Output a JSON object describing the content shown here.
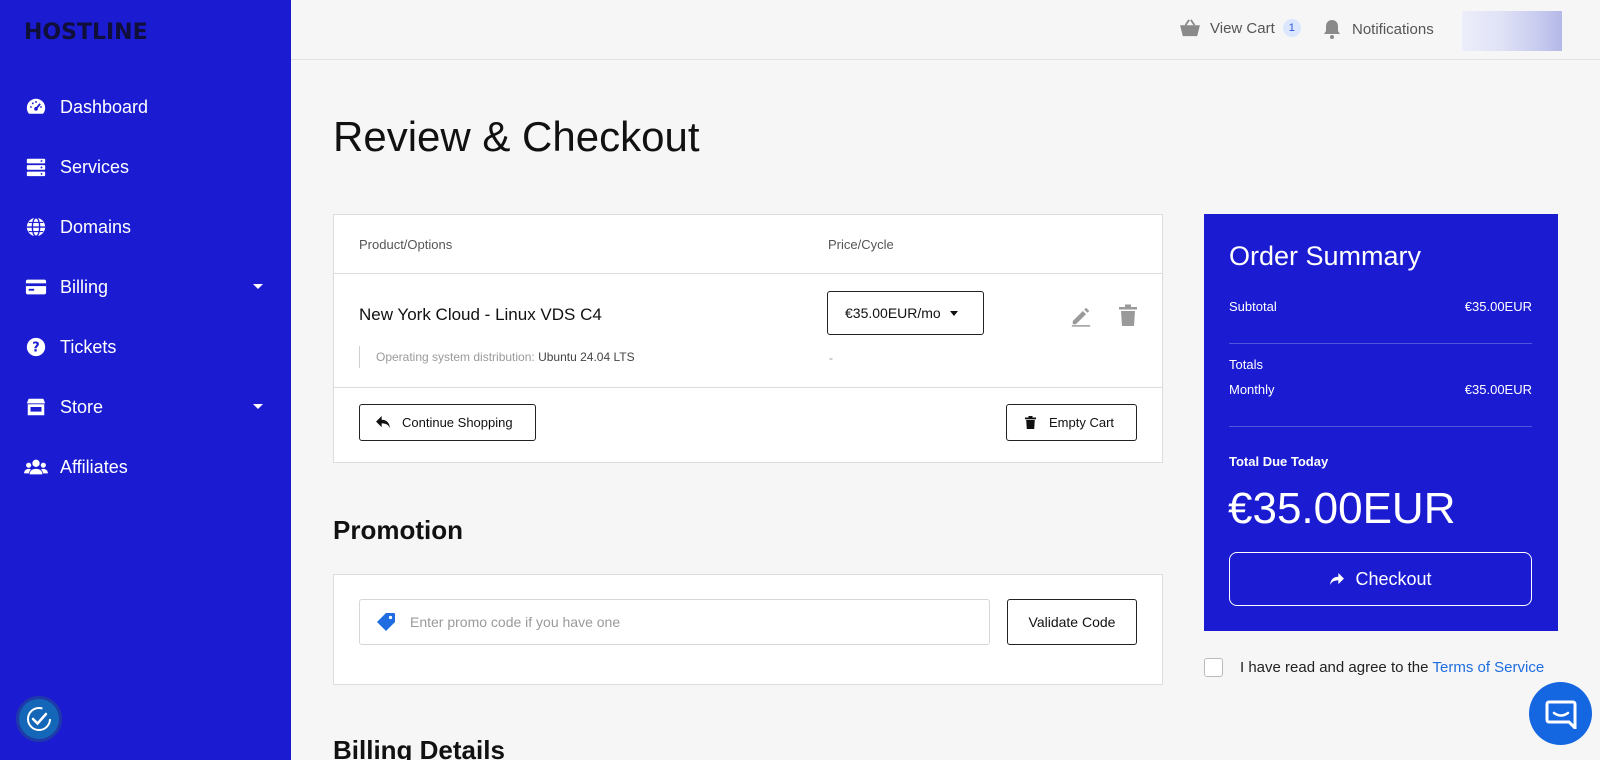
{
  "brand": {
    "logo": "HOSTLINE"
  },
  "sidebar": {
    "items": [
      {
        "label": "Dashboard",
        "icon": "dashboard-gauge-icon",
        "has_caret": false
      },
      {
        "label": "Services",
        "icon": "server-icon",
        "has_caret": false
      },
      {
        "label": "Domains",
        "icon": "globe-icon",
        "has_caret": false
      },
      {
        "label": "Billing",
        "icon": "credit-card-icon",
        "has_caret": true
      },
      {
        "label": "Tickets",
        "icon": "question-circle-icon",
        "has_caret": false
      },
      {
        "label": "Store",
        "icon": "store-icon",
        "has_caret": true
      },
      {
        "label": "Affiliates",
        "icon": "users-icon",
        "has_caret": false
      }
    ]
  },
  "topbar": {
    "cart_label": "View Cart",
    "cart_count": "1",
    "notifications_label": "Notifications"
  },
  "page": {
    "title": "Review & Checkout"
  },
  "cart": {
    "headers": {
      "product": "Product/Options",
      "price": "Price/Cycle"
    },
    "item": {
      "name": "New York Cloud - Linux VDS C4",
      "option_label": "Operating system distribution:",
      "option_value": "Ubuntu 24.04 LTS",
      "price_cycle": "€35.00EUR/mo",
      "setup": "-"
    },
    "continue_label": "Continue Shopping",
    "empty_label": "Empty Cart"
  },
  "promotion": {
    "title": "Promotion",
    "placeholder": "Enter promo code if you have one",
    "validate_label": "Validate Code"
  },
  "billing": {
    "title": "Billing Details"
  },
  "summary": {
    "title": "Order Summary",
    "subtotal_label": "Subtotal",
    "subtotal_value": "€35.00EUR",
    "totals_label": "Totals",
    "monthly_label": "Monthly",
    "monthly_value": "€35.00EUR",
    "due_label": "Total Due Today",
    "due_value": "€35.00EUR",
    "checkout_label": "Checkout"
  },
  "tos": {
    "text": "I have read and agree to the",
    "link": "Terms of Service"
  },
  "colors": {
    "brand": "#1b1bd2",
    "link": "#1f6de0",
    "chat": "#1467e0"
  }
}
